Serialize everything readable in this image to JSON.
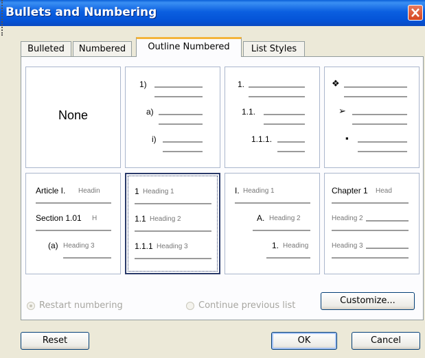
{
  "dialog": {
    "title": "Bullets and Numbering"
  },
  "tabs": [
    {
      "label": "Bulleted"
    },
    {
      "label": "Numbered"
    },
    {
      "label": "Outline Numbered",
      "active": true
    },
    {
      "label": "List Styles"
    }
  ],
  "gallery": {
    "none_label": "None",
    "cell2": [
      "1)",
      "a)",
      "i)"
    ],
    "cell3": [
      "1.",
      "1.1.",
      "1.1.1."
    ],
    "cell4": [
      "❖",
      "➢",
      "▪"
    ],
    "cell5": [
      {
        "num": "Article I.",
        "head": "Headin"
      },
      {
        "num": "Section 1.01",
        "head": "H"
      },
      {
        "num": "(a)",
        "head": "Heading 3"
      }
    ],
    "cell6": [
      {
        "num": "1",
        "head": "Heading 1"
      },
      {
        "num": "1.1",
        "head": "Heading 2"
      },
      {
        "num": "1.1.1",
        "head": "Heading 3"
      }
    ],
    "cell7": [
      {
        "num": "I.",
        "head": "Heading 1"
      },
      {
        "num": "A.",
        "head": "Heading 2"
      },
      {
        "num": "1.",
        "head": "Heading"
      }
    ],
    "cell8": [
      {
        "num": "Chapter 1",
        "head": "Head"
      },
      {
        "num": "",
        "head": "Heading 2"
      },
      {
        "num": "",
        "head": "Heading 3"
      }
    ]
  },
  "options": {
    "restart": "Restart numbering",
    "continue": "Continue previous list"
  },
  "buttons": {
    "customize": "Customize...",
    "reset": "Reset",
    "ok": "OK",
    "cancel": "Cancel"
  },
  "colors": {
    "accent": "#0452d6",
    "tab_highlight": "#f4b43a",
    "close": "#d54520"
  }
}
